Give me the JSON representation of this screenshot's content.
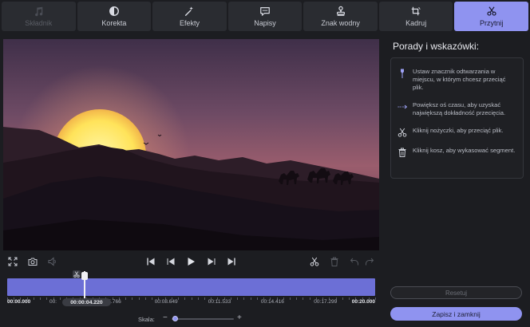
{
  "tabs": [
    {
      "label": "Składnik",
      "icon": "music-note-icon",
      "state": "disabled"
    },
    {
      "label": "Korekta",
      "icon": "contrast-icon",
      "state": "normal"
    },
    {
      "label": "Efekty",
      "icon": "magic-wand-icon",
      "state": "normal"
    },
    {
      "label": "Napisy",
      "icon": "speech-bubble-icon",
      "state": "normal"
    },
    {
      "label": "Znak wodny",
      "icon": "stamp-icon",
      "state": "normal"
    },
    {
      "label": "Kadruj",
      "icon": "crop-rotate-icon",
      "state": "normal"
    },
    {
      "label": "Przytnij",
      "icon": "scissors-icon",
      "state": "active"
    }
  ],
  "panel": {
    "title": "Porady i wskazówki:",
    "tips": [
      {
        "icon": "pin-marker-icon",
        "text": "Ustaw znacznik odtwarzania w miejscu, w którym chcesz przeciąć plik."
      },
      {
        "icon": "expand-arrows-icon",
        "text": "Powiększ oś czasu, aby uzyskać największą dokładność przecięcia."
      },
      {
        "icon": "scissors-icon",
        "text": "Kliknij nożyczki, aby przeciąć plik."
      },
      {
        "icon": "trash-icon",
        "text": "Kliknij kosz, aby wykasować segment."
      }
    ],
    "reset_label": "Resetuj",
    "save_label": "Zapisz i zamknij"
  },
  "timeline": {
    "current_time": "00:00:04.220",
    "playhead_fraction": 0.211,
    "tick_labels": [
      {
        "text": "00:00.000",
        "pos": 0.0,
        "bold": true
      },
      {
        "text": "00:",
        "pos": 0.115,
        "bold": false
      },
      {
        "text": "05.766",
        "pos": 0.288,
        "bold": false
      },
      {
        "text": "00:08.649",
        "pos": 0.432,
        "bold": false
      },
      {
        "text": "00:11.533",
        "pos": 0.577,
        "bold": false
      },
      {
        "text": "00:14.416",
        "pos": 0.721,
        "bold": false
      },
      {
        "text": "00:17.299",
        "pos": 0.865,
        "bold": false
      },
      {
        "text": "00:20.000",
        "pos": 1.0,
        "bold": true
      }
    ]
  },
  "scale": {
    "label": "Skala:",
    "minus": "−",
    "plus": "+",
    "level": 0.05
  },
  "colors": {
    "accent": "#8f93f0",
    "timeline": "#6c6fd6",
    "background": "#1c1d21"
  }
}
